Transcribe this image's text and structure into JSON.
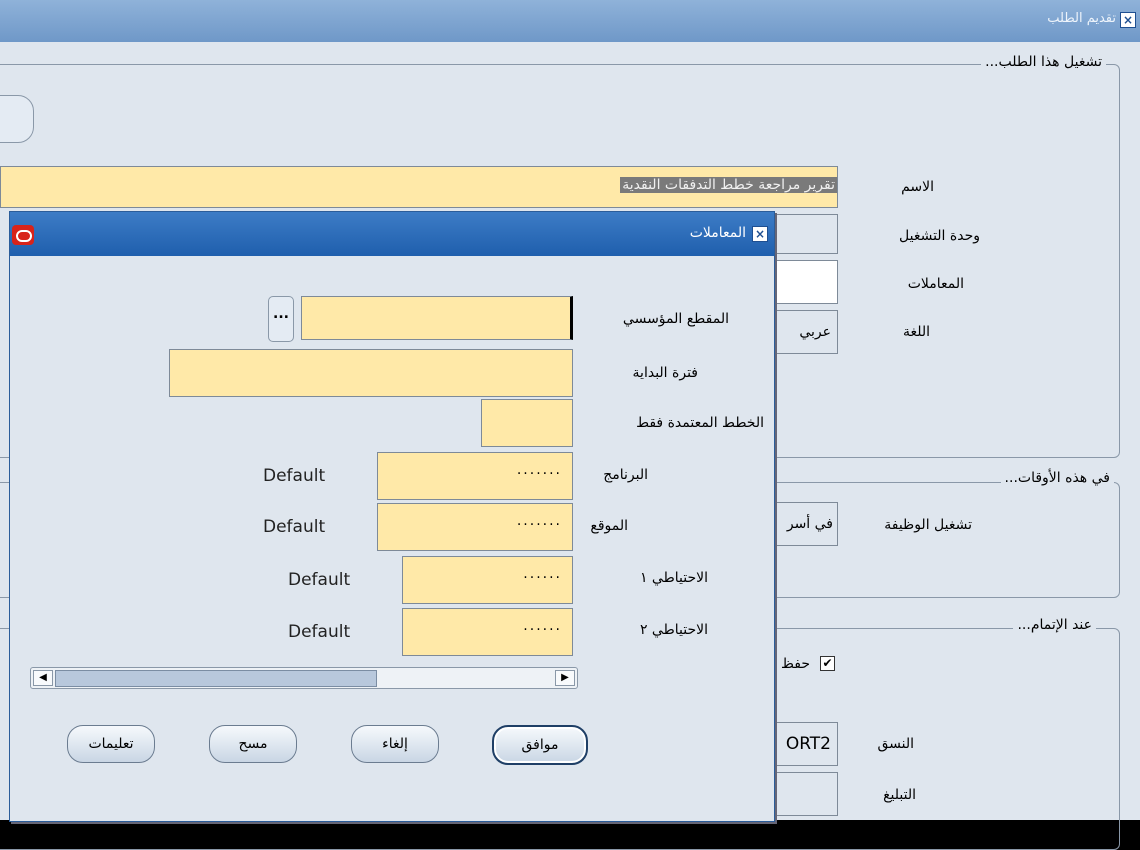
{
  "window": {
    "title": "تقديم الطلب"
  },
  "section_run": {
    "legend": "تشغيل هذا الطلب...",
    "name_label": "الاسم",
    "name_value": "تقرير مراجعة خطط التدفقات النقدية",
    "ou_label": "وحدة التشغيل",
    "params_label": "المعاملات",
    "language_label": "اللغة",
    "language_value": "عربي"
  },
  "section_times": {
    "legend": "في هذه الأوقات...",
    "run_job_label": "تشغيل الوظيفة",
    "run_job_value": "في أسر"
  },
  "section_completion": {
    "legend": "عند الإتمام...",
    "save_label": "حفظ",
    "save_checked": true,
    "format_label": "النسق",
    "format_value": "ORT2",
    "notify_label": "التبليغ"
  },
  "dialog": {
    "title": "المعاملات",
    "fields": [
      {
        "label": "المقطع المؤسسي",
        "value": ""
      },
      {
        "label": "فترة البداية",
        "value": ""
      },
      {
        "label": "الخطط المعتمدة فقط",
        "value": ""
      },
      {
        "label": "البرنامج",
        "value": "·······",
        "default": "Default"
      },
      {
        "label": "الموقع",
        "value": "·······",
        "default": "Default"
      },
      {
        "label": "الاحتياطي ١",
        "value": "······",
        "default": "Default"
      },
      {
        "label": "الاحتياطي ٢",
        "value": "······",
        "default": "Default"
      }
    ],
    "lov_button": "...",
    "buttons": {
      "ok": "موافق",
      "cancel": "إلغاء",
      "clear": "مسح",
      "help": "تعليمات"
    }
  }
}
